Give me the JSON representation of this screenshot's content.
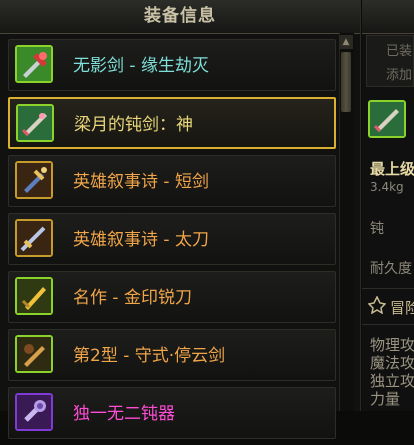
{
  "panel": {
    "title": "装备信息"
  },
  "items": [
    {
      "label": "无影剑 - 缘生劫灭",
      "color": "#7fe0d8",
      "frame": "green",
      "icon": "sword-red-icon",
      "selected": false
    },
    {
      "label": "梁月的钝剑：神",
      "color": "#e9d77a",
      "frame": "green",
      "icon": "blunt-sword-icon",
      "selected": true
    },
    {
      "label": "英雄叙事诗 - 短剑",
      "color": "#f0a548",
      "frame": "gold",
      "icon": "shortsword-icon",
      "selected": false
    },
    {
      "label": "英雄叙事诗 - 太刀",
      "color": "#f0a548",
      "frame": "gold",
      "icon": "katana-icon",
      "selected": false
    },
    {
      "label": "名作 - 金印锐刀",
      "color": "#f0a548",
      "frame": "green",
      "icon": "golden-blade-icon",
      "selected": false
    },
    {
      "label": "第2型 - 守式·停云剑",
      "color": "#f0a548",
      "frame": "green",
      "icon": "cloud-sword-icon",
      "selected": false
    },
    {
      "label": "独一无二钝器",
      "color": "#ff4dd6",
      "frame": "pink",
      "icon": "club-icon",
      "selected": false
    }
  ],
  "detail": {
    "line1": "已装",
    "line2": "添加",
    "name": "最上级",
    "weight": "3.4kg",
    "row3": "钝",
    "durability": "耐久度",
    "section": "冒险",
    "stat1": "物理攻",
    "stat2": "魔法攻",
    "stat3": "独立攻",
    "stat4": "力量"
  }
}
